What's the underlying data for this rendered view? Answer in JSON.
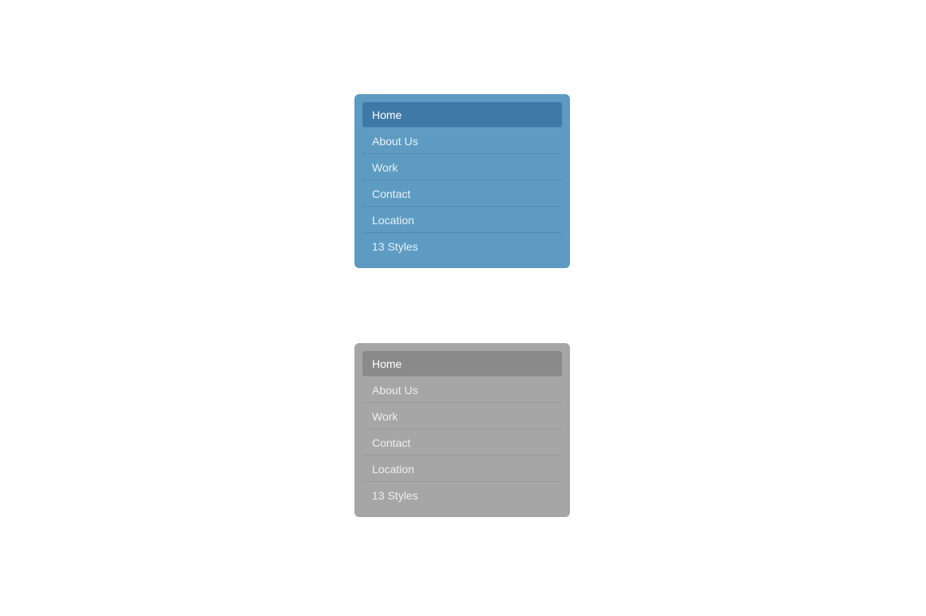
{
  "menu_blue": {
    "theme": "blue",
    "bg": "#5d9bc2",
    "active_bg": "#3f79a8",
    "items": [
      {
        "label": "Home",
        "active": true
      },
      {
        "label": "About Us",
        "active": false
      },
      {
        "label": "Work",
        "active": false
      },
      {
        "label": "Contact",
        "active": false
      },
      {
        "label": "Location",
        "active": false
      },
      {
        "label": "13 Styles",
        "active": false
      }
    ]
  },
  "menu_gray": {
    "theme": "gray",
    "bg": "#a6a6a6",
    "active_bg": "#8a8a8a",
    "items": [
      {
        "label": "Home",
        "active": true
      },
      {
        "label": "About Us",
        "active": false
      },
      {
        "label": "Work",
        "active": false
      },
      {
        "label": "Contact",
        "active": false
      },
      {
        "label": "Location",
        "active": false
      },
      {
        "label": "13 Styles",
        "active": false
      }
    ]
  }
}
